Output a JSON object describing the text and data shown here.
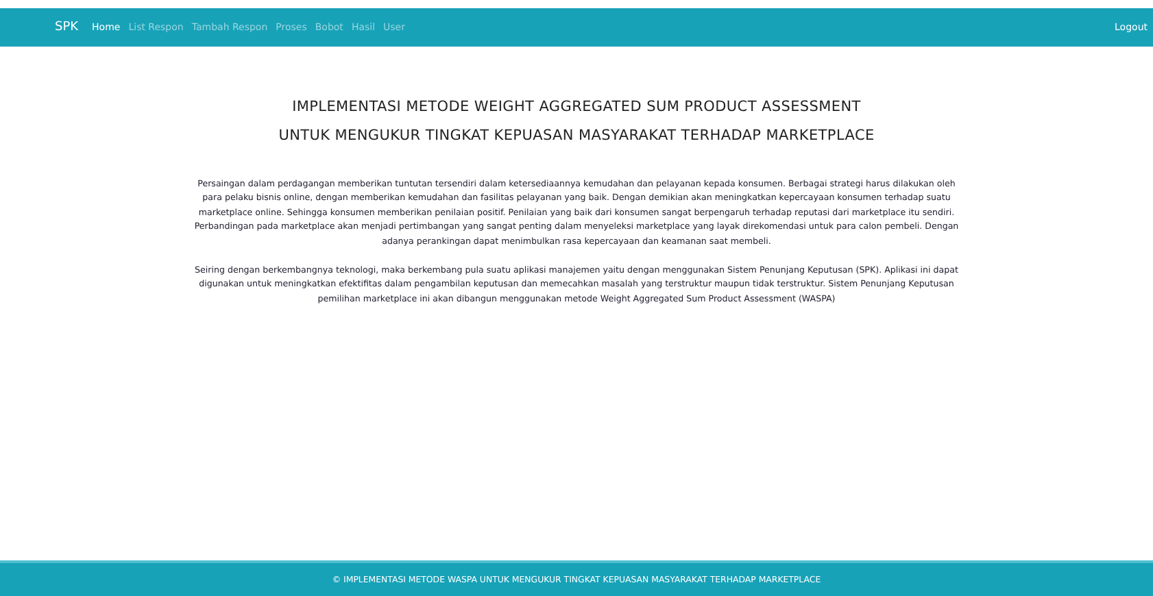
{
  "navbar": {
    "brand": "SPK",
    "links": [
      {
        "label": "Home",
        "selected": true
      },
      {
        "label": "List Respon",
        "selected": false
      },
      {
        "label": "Tambah Respon",
        "selected": false
      },
      {
        "label": "Proses",
        "selected": false
      },
      {
        "label": "Bobot",
        "selected": false
      },
      {
        "label": "Hasil",
        "selected": false
      },
      {
        "label": "User",
        "selected": false
      }
    ],
    "logout": "Logout"
  },
  "content": {
    "title_lines": [
      "IMPLEMENTASI METODE WEIGHT AGGREGATED SUM PRODUCT ASSESSMENT",
      "UNTUK MENGUKUR TINGKAT KEPUASAN MASYARAKAT TERHADAP MARKETPLACE"
    ],
    "paragraphs": [
      "Persaingan dalam perdagangan memberikan tuntutan tersendiri dalam ketersediaannya kemudahan dan pelayanan kepada konsumen. Berbagai strategi harus dilakukan oleh para pelaku bisnis online, dengan memberikan kemudahan dan fasilitas pelayanan yang baik. Dengan demikian akan meningkatkan kepercayaan konsumen terhadap suatu marketplace online. Sehingga konsumen memberikan penilaian positif. Penilaian yang baik dari konsumen sangat berpengaruh terhadap reputasi dari marketplace itu sendiri. Perbandingan pada marketplace akan menjadi pertimbangan yang sangat penting dalam menyeleksi marketplace yang layak direkomendasi untuk para calon pembeli. Dengan adanya perankingan dapat menimbulkan rasa kepercayaan dan keamanan saat membeli.",
      "Seiring dengan berkembangnya teknologi, maka berkembang pula suatu aplikasi manajemen yaitu dengan menggunakan Sistem Penunjang Keputusan (SPK). Aplikasi ini dapat digunakan untuk meningkatkan efektifitas dalam pengambilan keputusan dan memecahkan masalah yang terstruktur maupun tidak terstruktur. Sistem Penunjang Keputusan pemilihan marketplace ini akan dibangun menggunakan metode Weight Aggregated Sum Product Assessment (WASPA)"
    ]
  },
  "footer": "© IMPLEMENTASI METODE WASPA UNTUK MENGUKUR TINGKAT KEPUASAN MASYARAKAT TERHADAP MARKETPLACE"
}
